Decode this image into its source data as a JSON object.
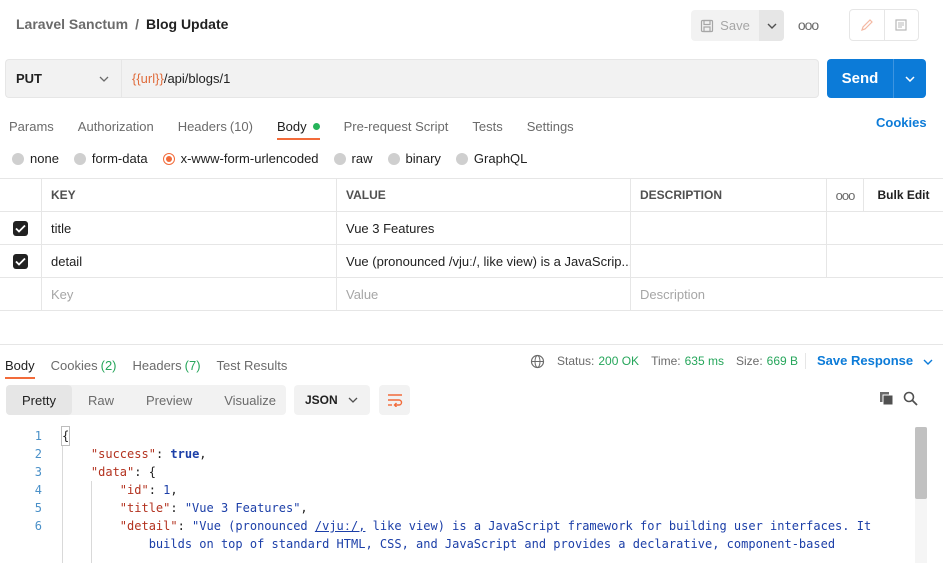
{
  "header": {
    "breadcrumb_parent": "Laravel Sanctum",
    "breadcrumb_sep": "/",
    "breadcrumb_current": "Blog Update",
    "save_label": "Save",
    "more": "ooo"
  },
  "request": {
    "method": "PUT",
    "url_var": "{{url}}",
    "url_path": "/api/blogs/1",
    "send_label": "Send"
  },
  "tabs": [
    {
      "label": "Params",
      "count": ""
    },
    {
      "label": "Authorization",
      "count": ""
    },
    {
      "label": "Headers",
      "count": "(10)"
    },
    {
      "label": "Body",
      "count": "",
      "active": true
    },
    {
      "label": "Pre-request Script",
      "count": ""
    },
    {
      "label": "Tests",
      "count": ""
    },
    {
      "label": "Settings",
      "count": ""
    }
  ],
  "cookies_link": "Cookies",
  "body_types": [
    "none",
    "form-data",
    "x-www-form-urlencoded",
    "raw",
    "binary",
    "GraphQL"
  ],
  "selected_body_type": "x-www-form-urlencoded",
  "table": {
    "headers": {
      "key": "KEY",
      "value": "VALUE",
      "description": "DESCRIPTION",
      "more": "ooo",
      "bulk": "Bulk Edit"
    },
    "rows": [
      {
        "checked": true,
        "key": "title",
        "value": "Vue 3 Features",
        "description": ""
      },
      {
        "checked": true,
        "key": "detail",
        "value": "Vue (pronounced /vjuː/, like view) is a JavaScrip...",
        "description": ""
      }
    ],
    "placeholder": {
      "key": "Key",
      "value": "Value",
      "description": "Description"
    }
  },
  "response": {
    "tabs": [
      {
        "label": "Body",
        "count": ""
      },
      {
        "label": "Cookies",
        "count": "(2)"
      },
      {
        "label": "Headers",
        "count": "(7)"
      },
      {
        "label": "Test Results",
        "count": ""
      }
    ],
    "status_label": "Status:",
    "status_value": "200 OK",
    "time_label": "Time:",
    "time_value": "635 ms",
    "size_label": "Size:",
    "size_value": "669 B",
    "save_response": "Save Response",
    "view_tabs": [
      "Pretty",
      "Raw",
      "Preview",
      "Visualize"
    ],
    "format": "JSON"
  },
  "code": {
    "line_numbers": [
      "1",
      "2",
      "3",
      "4",
      "5",
      "6"
    ],
    "open_brace": "{",
    "success_key": "\"success\"",
    "success_val": "true",
    "data_key": "\"data\"",
    "data_open": "{",
    "id_key": "\"id\"",
    "id_val": "1",
    "title_key": "\"title\"",
    "title_val": "\"Vue 3 Features\"",
    "detail_key": "\"detail\"",
    "detail_val_1a": "\"Vue (pronounced ",
    "detail_val_1b": "/vjuː/,",
    "detail_val_1c": " like view) is a JavaScript framework for building user interfaces. It",
    "detail_val_2": "builds on top of standard HTML, CSS, and JavaScript and provides a declarative, component-based"
  }
}
